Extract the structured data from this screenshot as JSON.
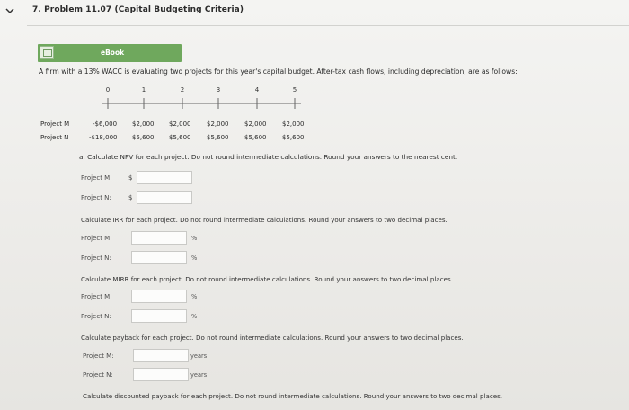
{
  "problem": {
    "title": "7. Problem 11.07 (Capital Budgeting Criteria)"
  },
  "ebook": {
    "label": "eBook",
    "icon": "book-icon"
  },
  "intro": "A firm with a 13% WACC is evaluating two projects for this year's capital budget. After-tax cash flows, including depreciation, are as follows:",
  "timeline": {
    "years": [
      "0",
      "1",
      "2",
      "3",
      "4",
      "5"
    ]
  },
  "projects": [
    {
      "name": "Project M",
      "flows": [
        "-$6,000",
        "$2,000",
        "$2,000",
        "$2,000",
        "$2,000",
        "$2,000"
      ]
    },
    {
      "name": "Project N",
      "flows": [
        "-$18,000",
        "$5,600",
        "$5,600",
        "$5,600",
        "$5,600",
        "$5,600"
      ]
    }
  ],
  "part_a": "a. Calculate NPV for each project. Do not round intermediate calculations. Round your answers to the nearest cent.",
  "npv": {
    "m_label": "Project M:",
    "n_label": "Project N:",
    "currency": "$",
    "m_value": "",
    "n_value": ""
  },
  "irr": {
    "instruction": "Calculate IRR for each project. Do not round intermediate calculations. Round your answers to two decimal places.",
    "m_label": "Project M:",
    "n_label": "Project N:",
    "unit": "%",
    "m_value": "",
    "n_value": ""
  },
  "mirr": {
    "instruction": "Calculate MIRR for each project. Do not round intermediate calculations. Round your answers to two decimal places.",
    "m_label": "Project M:",
    "n_label": "Project N:",
    "unit": "%",
    "m_value": "",
    "n_value": ""
  },
  "payback": {
    "instruction": "Calculate payback for each project. Do not round intermediate calculations. Round your answers to two decimal places.",
    "m_label": "Project M:",
    "n_label": "Project N:",
    "unit": "years",
    "m_value": "",
    "n_value": ""
  },
  "discounted_payback": {
    "instruction": "Calculate discounted payback for each project. Do not round intermediate calculations. Round your answers to two decimal places."
  }
}
